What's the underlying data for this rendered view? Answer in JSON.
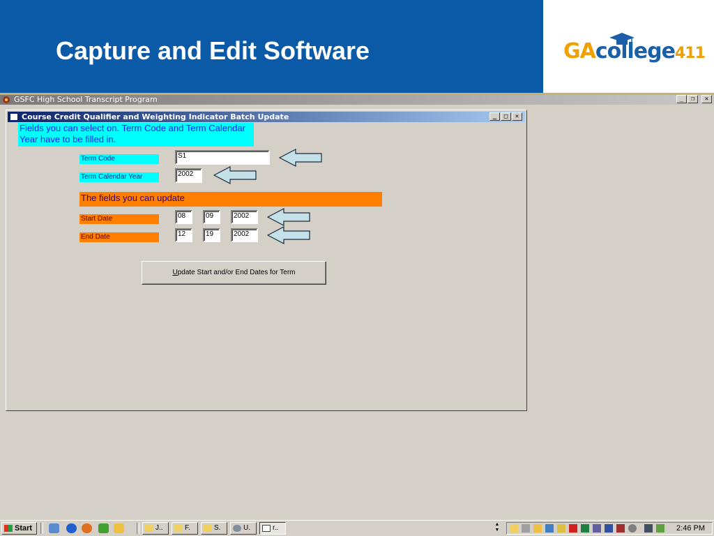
{
  "slide": {
    "title": "Capture and Edit Software",
    "logo": {
      "ga": "GA",
      "college": "college",
      "num": "411"
    },
    "brand_color": "#0b5aa8"
  },
  "app_window": {
    "title": "GSFC High School Transcript Program",
    "buttons": {
      "minimize": "_",
      "restore": "❐",
      "close": "✕"
    }
  },
  "dialog": {
    "title": "Course Credit Qualifier and Weighting Indicator Batch Update",
    "buttons": {
      "minimize": "_",
      "maximize": "□",
      "close": "✕"
    },
    "note": "Fields you can select on.  Term Code and Term Calendar Year have to be filled in.",
    "term_code_label": "Term Code",
    "term_code_value": "S1",
    "term_year_label": "Term Calendar Year",
    "term_year_value": "2002",
    "update_header": "The fields you can update",
    "start_date_label": "Start Date",
    "start_date": {
      "month": "08",
      "day": "09",
      "year": "2002"
    },
    "end_date_label": "End Date",
    "end_date": {
      "month": "12",
      "day": "19",
      "year": "2002"
    },
    "update_button_underline": "U",
    "update_button_rest": "pdate Start and/or End Dates for Term"
  },
  "taskbar": {
    "start_label": "Start",
    "quick_launch_icons": [
      "desktop-icon",
      "ie-icon",
      "firefox-icon",
      "app-icon",
      "outlook-icon"
    ],
    "tasks": [
      {
        "label": "J..",
        "icon": "mail-icon"
      },
      {
        "label": "F.",
        "icon": "mail-icon"
      },
      {
        "label": "S.",
        "icon": "mail-icon"
      },
      {
        "label": "U.",
        "icon": "app-icon"
      },
      {
        "label": "r..",
        "icon": "window-icon",
        "active": true
      }
    ],
    "clock": "2:46 PM"
  }
}
